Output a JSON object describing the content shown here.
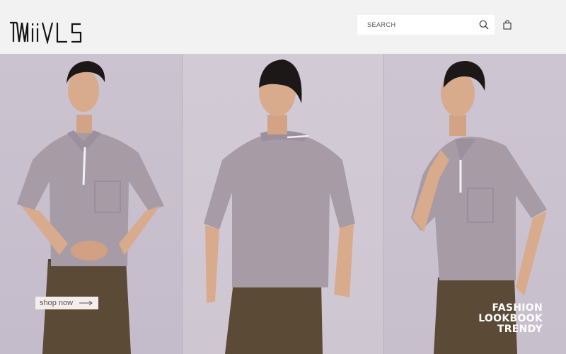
{
  "header": {
    "brand": "MIIVLS",
    "search": {
      "placeholder": "SEARCH",
      "value": ""
    }
  },
  "hero": {
    "cta_label": "shop now",
    "tagline": [
      "FASHION",
      "LOOKBOOK",
      "TRENDY"
    ]
  },
  "colors": {
    "header_bg": "#f2f2f2",
    "shirt": "#a79ca6",
    "pants": "#5a4a36",
    "hair": "#1c1818",
    "skin": "#d9ab8d"
  },
  "icons": [
    "search-icon",
    "shopping-bag-icon",
    "arrow-right-icon"
  ]
}
